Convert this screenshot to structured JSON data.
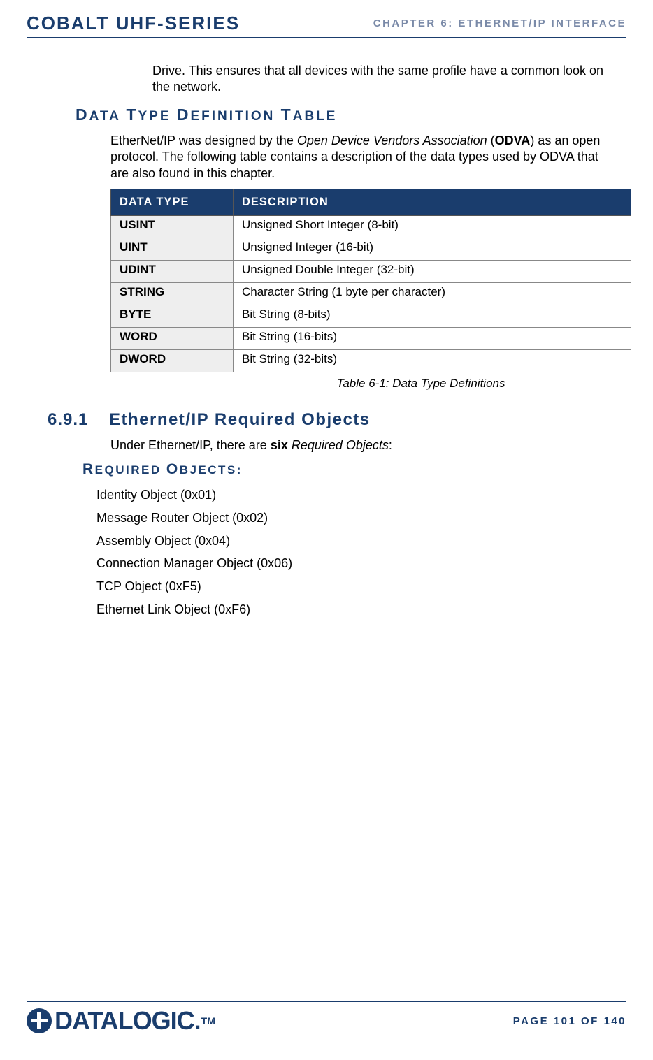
{
  "header": {
    "left": "COBALT UHF-SERIES",
    "right": "CHAPTER 6: ETHERNET/IP INTERFACE"
  },
  "intro_paragraph": "Drive. This ensures that all devices with the same profile have a common look on the network.",
  "data_type_heading_1": "D",
  "data_type_heading_2": "ATA ",
  "data_type_heading_3": "T",
  "data_type_heading_4": "YPE ",
  "data_type_heading_5": "D",
  "data_type_heading_6": "EFINITION ",
  "data_type_heading_7": "T",
  "data_type_heading_8": "ABLE",
  "section_text_1": "EtherNet/IP was designed by the ",
  "section_text_italic": "Open Device Vendors Association",
  "section_text_2": " (",
  "section_text_bold": "ODVA",
  "section_text_3": ") as an open protocol. The following table contains a description of the data types used by ODVA that are also found in this chapter.",
  "table": {
    "headers": [
      "DATA TYPE",
      "DESCRIPTION"
    ],
    "rows": [
      [
        "USINT",
        "Unsigned Short Integer (8-bit)"
      ],
      [
        "UINT",
        "Unsigned Integer (16-bit)"
      ],
      [
        "UDINT",
        "Unsigned Double Integer (32-bit)"
      ],
      [
        "STRING",
        "Character String (1 byte per character)"
      ],
      [
        "BYTE",
        "Bit String (8-bits)"
      ],
      [
        "WORD",
        "Bit String (16-bits)"
      ],
      [
        "DWORD",
        "Bit String (32-bits)"
      ]
    ]
  },
  "table_caption": "Table 6-1: Data Type Definitions",
  "section_691": {
    "number": "6.9.1",
    "title": "Ethernet/IP Required Objects"
  },
  "req_intro_1": "Under Ethernet/IP, there are ",
  "req_intro_bold": "six",
  "req_intro_italic": " Required Objects",
  "req_intro_2": ":",
  "req_heading_1": "R",
  "req_heading_2": "EQUIRED ",
  "req_heading_3": "O",
  "req_heading_4": "BJECTS",
  "req_heading_5": ":",
  "objects": [
    "Identity Object (0x01)",
    "Message Router Object (0x02)",
    "Assembly Object (0x04)",
    "Connection Manager Object (0x06)",
    "TCP Object (0xF5)",
    "Ethernet Link Object (0xF6)"
  ],
  "footer": {
    "logo_text": "DATALOGIC.",
    "tm": "TM",
    "page": "PAGE 101 OF 140"
  }
}
